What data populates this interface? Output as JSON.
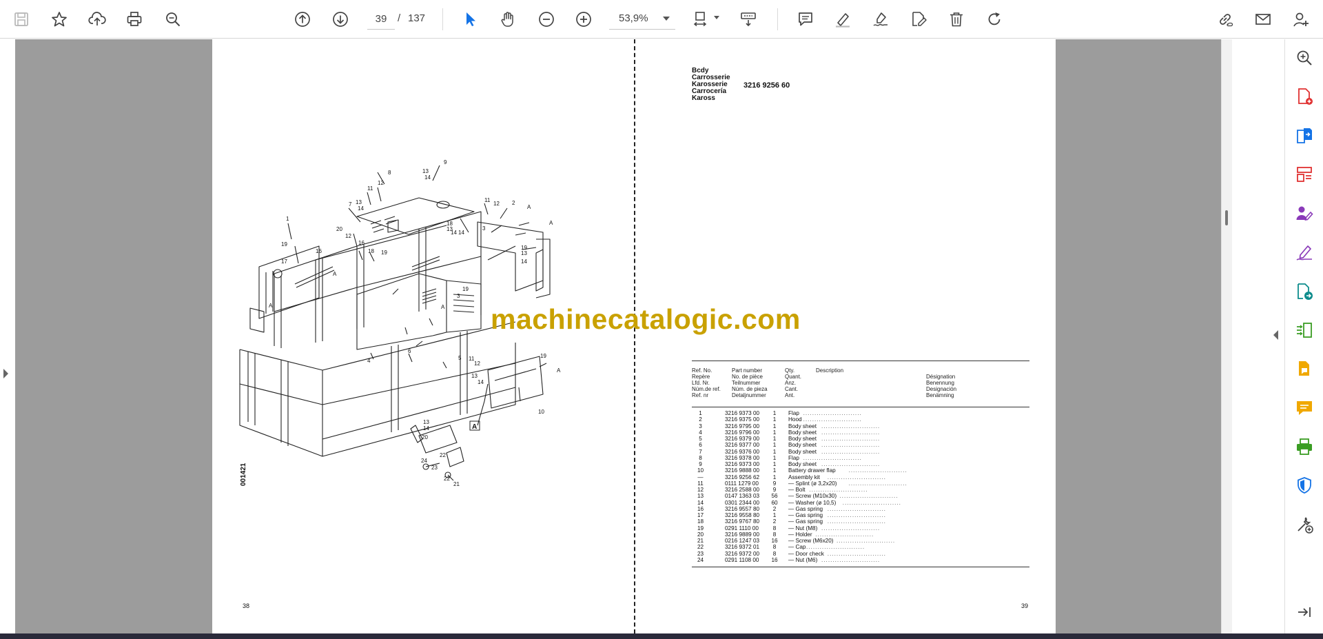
{
  "toolbar": {
    "current_page": "39",
    "page_separator": "/",
    "total_pages": "137",
    "zoom": "53,9%"
  },
  "document": {
    "left_page_number": "38",
    "right_page_number": "39",
    "drawing_code": "001421",
    "watermark": "machinecatalogic.com",
    "title_lines": [
      "Bcdy",
      "Carrosserie",
      "Karosserie",
      "Carrocería",
      "Kaross"
    ],
    "part_code": "3216 9256 60",
    "headers": {
      "ref": [
        "Ref. No.",
        "Repère",
        "Lfd. Nr.",
        "Núm.de ref.",
        "Ref. nr"
      ],
      "part": [
        "Part number",
        "No. de pièce",
        "Teilnummer",
        "Núm. de pieza",
        "Detaljnummer"
      ],
      "qty": [
        "Qty.",
        "Quant.",
        "Anz.",
        "Cant.",
        "Ant."
      ],
      "desc": [
        "Description"
      ],
      "designation": [
        "Désignation",
        "Benennung",
        "Designación",
        "Benämning"
      ]
    },
    "parts": [
      {
        "ref": "1",
        "part": "3216 9373 00",
        "qty": "1",
        "desc": "Flap"
      },
      {
        "ref": "2",
        "part": "3216 9375 00",
        "qty": "1",
        "desc": "Hood"
      },
      {
        "ref": "3",
        "part": "3216 9795 00",
        "qty": "1",
        "desc": "Body sheet"
      },
      {
        "ref": "4",
        "part": "3216 9796 00",
        "qty": "1",
        "desc": "Body sheet"
      },
      {
        "ref": "5",
        "part": "3216 9379 00",
        "qty": "1",
        "desc": "Body sheet"
      },
      {
        "ref": "6",
        "part": "3216 9377 00",
        "qty": "1",
        "desc": "Body sheet"
      },
      {
        "ref": "7",
        "part": "3216 9376 00",
        "qty": "1",
        "desc": "Body sheet"
      },
      {
        "ref": "8",
        "part": "3216 9378 00",
        "qty": "1",
        "desc": "Flap"
      },
      {
        "ref": "9",
        "part": "3216 9373 00",
        "qty": "1",
        "desc": "Body sheet"
      },
      {
        "ref": "10",
        "part": "3216 9888 00",
        "qty": "1",
        "desc": "Battery drawer flap"
      },
      {
        "ref": "—",
        "part": "3216 9256 62",
        "qty": "1",
        "desc": "Assembly kit"
      },
      {
        "ref": "11",
        "part": "0111 1279 00",
        "qty": "9",
        "desc": "— Splint (ø 3,2x20)"
      },
      {
        "ref": "12",
        "part": "3216 2588 00",
        "qty": "9",
        "desc": "— Bolt"
      },
      {
        "ref": "13",
        "part": "0147 1363 03",
        "qty": "56",
        "desc": "— Screw (M10x30)"
      },
      {
        "ref": "14",
        "part": "0301 2344 00",
        "qty": "60",
        "desc": "— Washer (ø 10,5)"
      },
      {
        "ref": "16",
        "part": "3216 9557 80",
        "qty": "2",
        "desc": "— Gas spring"
      },
      {
        "ref": "17",
        "part": "3216 9558 80",
        "qty": "1",
        "desc": "— Gas spring"
      },
      {
        "ref": "18",
        "part": "3216 9767 80",
        "qty": "2",
        "desc": "— Gas spring"
      },
      {
        "ref": "19",
        "part": "0291 1110 00",
        "qty": "8",
        "desc": "— Nut (M8)"
      },
      {
        "ref": "20",
        "part": "3216 9889 00",
        "qty": "8",
        "desc": "— Holder"
      },
      {
        "ref": "21",
        "part": "0216 1247 03",
        "qty": "16",
        "desc": "— Screw (M6x20)"
      },
      {
        "ref": "22",
        "part": "3216 9372 01",
        "qty": "8",
        "desc": "— Cap"
      },
      {
        "ref": "23",
        "part": "3216 9372 00",
        "qty": "8",
        "desc": "— Door check"
      },
      {
        "ref": "24",
        "part": "0291 1108 00",
        "qty": "16",
        "desc": "— Nut (M6)"
      }
    ],
    "callouts": [
      "1",
      "2",
      "3",
      "4",
      "5",
      "6",
      "7",
      "8",
      "9",
      "10",
      "11",
      "12",
      "13",
      "14",
      "16",
      "17",
      "18",
      "19",
      "20",
      "21",
      "22",
      "23",
      "24",
      "A"
    ]
  },
  "icons": {
    "toolbar_left": [
      "save-icon",
      "bookmark-star-icon",
      "upload-cloud-icon",
      "print-icon",
      "zoom-search-icon"
    ],
    "toolbar_nav": [
      "page-up-icon",
      "page-down-icon",
      "zoom-out-icon",
      "zoom-in-icon"
    ],
    "toolbar_tools": [
      "select-cursor-icon",
      "hand-tool-icon",
      "page-fit-icon",
      "scroll-mode-icon",
      "comment-icon",
      "highlight-icon",
      "sign-icon",
      "edit-pdf-icon",
      "delete-icon",
      "rotate-icon"
    ],
    "toolbar_right": [
      "share-link-icon",
      "email-icon",
      "account-icon"
    ],
    "right_panel": [
      "zoom-icon",
      "create-pdf-icon",
      "export-pdf-icon",
      "organize-pages-icon",
      "request-sign-icon",
      "fill-sign-icon",
      "send-review-icon",
      "compress-icon",
      "comment-tool-icon",
      "note-icon",
      "print-production-icon",
      "protect-icon",
      "more-tools-icon",
      "collapse-panel-icon"
    ]
  },
  "colors": {
    "accent_blue": "#1473e6",
    "tool_purple": "#8a3ab9",
    "watermark": "#c9a100",
    "viewer_bg": "#9c9c9c"
  }
}
